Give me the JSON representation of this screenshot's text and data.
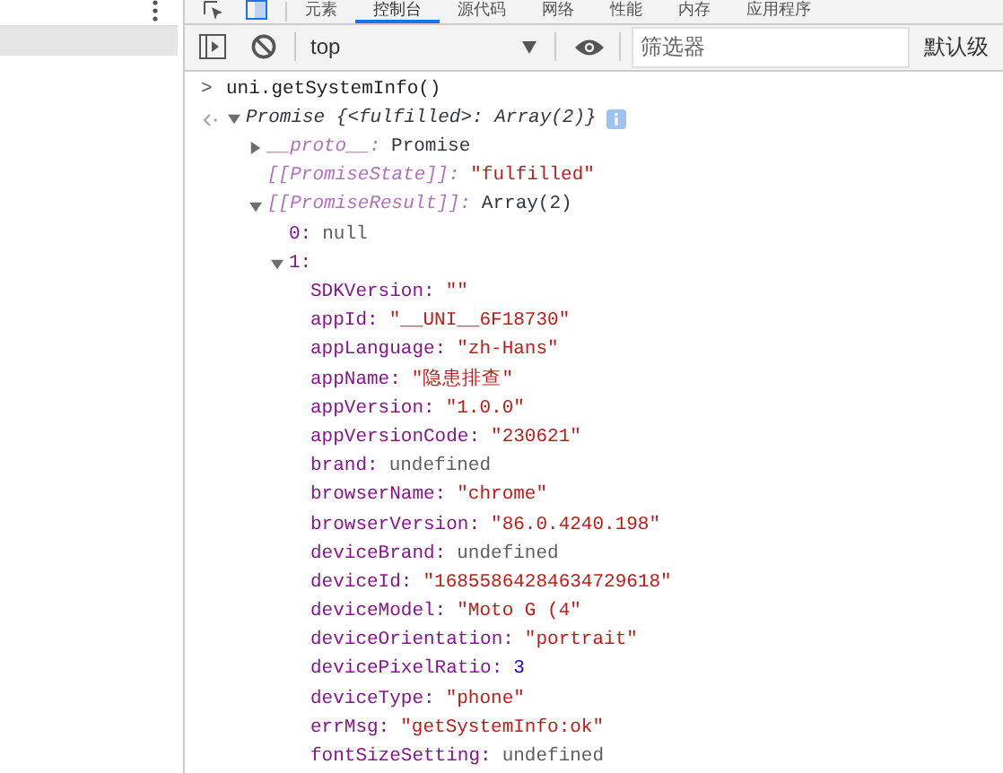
{
  "tabs": [
    {
      "label": "元素",
      "selected": false
    },
    {
      "label": "控制台",
      "selected": true
    },
    {
      "label": "源代码",
      "selected": false
    },
    {
      "label": "网络",
      "selected": false
    },
    {
      "label": "性能",
      "selected": false
    },
    {
      "label": "内存",
      "selected": false
    },
    {
      "label": "应用程序",
      "selected": false
    }
  ],
  "toolbar": {
    "context": "top",
    "filter": {
      "placeholder": "筛选器"
    },
    "levels": "默认级"
  },
  "console": [
    {
      "kind": "input",
      "prompt": ">",
      "text": "uni.getSystemInfo()"
    },
    {
      "kind": "output",
      "summary": "Promise {<fulfilled>: Array(2)}",
      "expanded": true,
      "children": [
        {
          "key": "__proto__:",
          "value": "Promise",
          "kind": "plain",
          "dim": true,
          "expanded": false
        },
        {
          "key": "[[PromiseState]]:",
          "value": "\"fulfilled\"",
          "kind": "string",
          "dim": true
        },
        {
          "key": "[[PromiseResult]]:",
          "value": "Array(2)",
          "kind": "plain",
          "dim": true,
          "expanded": true,
          "children": [
            {
              "key": "0:",
              "value": "null",
              "kind": "null",
              "dim": false
            },
            {
              "key": "1:",
              "dim": false,
              "expanded": true,
              "children": [
                {
                  "key": "SDKVersion:",
                  "value": "\"\"",
                  "kind": "string",
                  "dim": false
                },
                {
                  "key": "appId:",
                  "value": "\"__UNI__6F18730\"",
                  "kind": "string",
                  "dim": false
                },
                {
                  "key": "appLanguage:",
                  "value": "\"zh-Hans\"",
                  "kind": "string",
                  "dim": false
                },
                {
                  "key": "appName:",
                  "value": "\"隐患排查\"",
                  "kind": "string",
                  "dim": false
                },
                {
                  "key": "appVersion:",
                  "value": "\"1.0.0\"",
                  "kind": "string",
                  "dim": false
                },
                {
                  "key": "appVersionCode:",
                  "value": "\"230621\"",
                  "kind": "string",
                  "dim": false
                },
                {
                  "key": "brand:",
                  "value": "undefined",
                  "kind": "null",
                  "dim": false
                },
                {
                  "key": "browserName:",
                  "value": "\"chrome\"",
                  "kind": "string",
                  "dim": false
                },
                {
                  "key": "browserVersion:",
                  "value": "\"86.0.4240.198\"",
                  "kind": "string",
                  "dim": false
                },
                {
                  "key": "deviceBrand:",
                  "value": "undefined",
                  "kind": "null",
                  "dim": false
                },
                {
                  "key": "deviceId:",
                  "value": "\"16855864284634729618\"",
                  "kind": "string",
                  "dim": false
                },
                {
                  "key": "deviceModel:",
                  "value": "\"Moto G (4\"",
                  "kind": "string",
                  "dim": false
                },
                {
                  "key": "deviceOrientation:",
                  "value": "\"portrait\"",
                  "kind": "string",
                  "dim": false
                },
                {
                  "key": "devicePixelRatio:",
                  "value": "3",
                  "kind": "number",
                  "dim": false
                },
                {
                  "key": "deviceType:",
                  "value": "\"phone\"",
                  "kind": "string",
                  "dim": false
                },
                {
                  "key": "errMsg:",
                  "value": "\"getSystemInfo:ok\"",
                  "kind": "string",
                  "dim": false
                },
                {
                  "key": "fontSizeSetting:",
                  "value": "undefined",
                  "kind": "null",
                  "dim": false
                }
              ]
            }
          ]
        }
      ]
    }
  ]
}
